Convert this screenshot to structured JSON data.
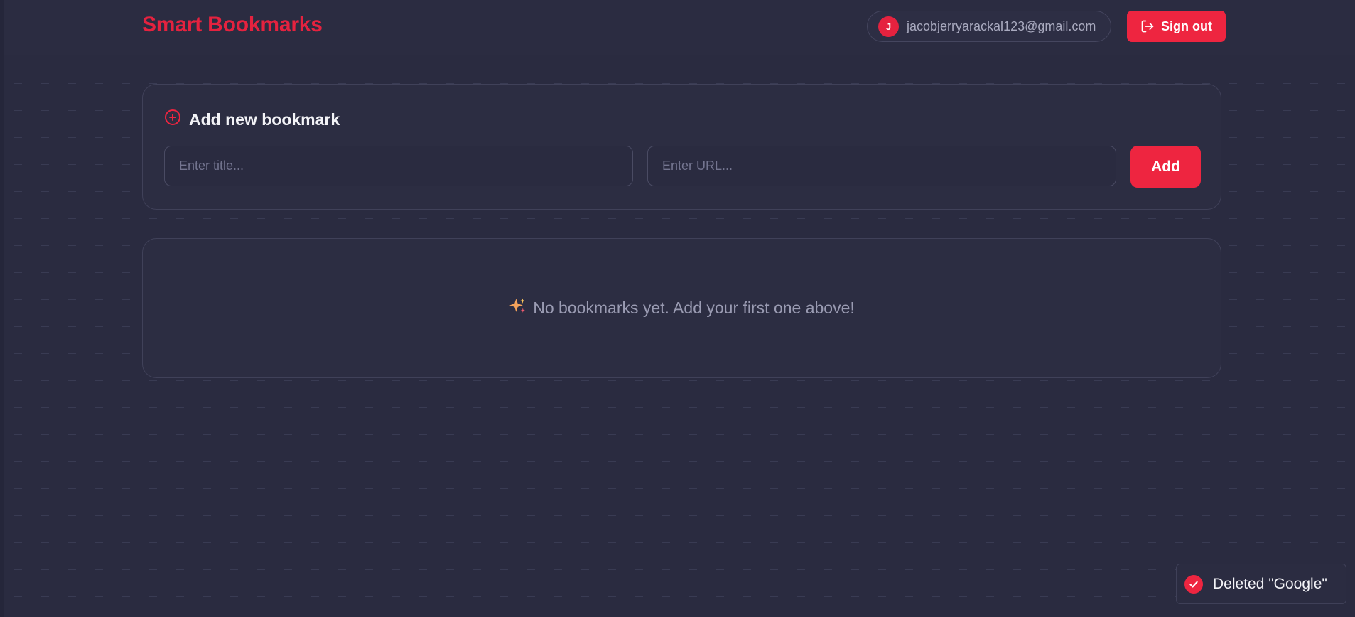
{
  "app": {
    "brand": "Smart Bookmarks",
    "accent_color": "#ee2540"
  },
  "header": {
    "user": {
      "avatar_initial": "J",
      "email": "jacobjerryarackal123@gmail.com"
    },
    "signout": {
      "label": "Sign out",
      "icon": "logout-icon"
    }
  },
  "add_bookmark": {
    "title": "Add new bookmark",
    "icon": "plus-circle-icon",
    "title_input": {
      "value": "",
      "placeholder": "Enter title..."
    },
    "url_input": {
      "value": "",
      "placeholder": "Enter URL..."
    },
    "add_label": "Add"
  },
  "bookmarks": {
    "items": [],
    "empty_message": "No bookmarks yet. Add your first one above!",
    "empty_icon": "sparkles-icon"
  },
  "toast": {
    "message": "Deleted \"Google\"",
    "icon": "check-circle-icon"
  }
}
